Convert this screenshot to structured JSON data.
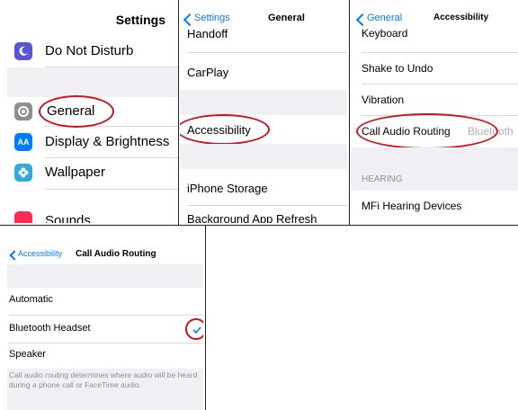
{
  "colors": {
    "accent": "#007aff",
    "highlight": "#d0101a",
    "group_bg": "#efeff4"
  },
  "panel1": {
    "title": "Settings",
    "items": [
      {
        "label": "Do Not Disturb",
        "icon": "moon-icon",
        "color": "#5856d6"
      },
      {
        "label": "General",
        "icon": "gear-icon",
        "color": "#8e8e93"
      },
      {
        "label": "Display & Brightness",
        "icon": "display-brightness-icon",
        "color": "#007aff"
      },
      {
        "label": "Wallpaper",
        "icon": "wallpaper-flower-icon",
        "color": "#34aadc"
      },
      {
        "label": "Sounds",
        "icon": "speaker-icon",
        "color": "#ff2d55"
      }
    ]
  },
  "panel2": {
    "back": "Settings",
    "title": "General",
    "items": [
      "Handoff",
      "CarPlay",
      "Accessibility",
      "iPhone Storage",
      "Background App Refresh"
    ]
  },
  "panel3": {
    "back": "General",
    "title": "Accessibility",
    "items": [
      "Keyboard",
      "Shake to Undo",
      "Vibration"
    ],
    "call_audio": {
      "label": "Call Audio Routing",
      "value": "Bluetooth"
    },
    "section_header": "HEARING",
    "hearing_items": [
      "MFi Hearing Devices"
    ]
  },
  "panel4": {
    "back": "Accessibility",
    "title": "Call Audio Routing",
    "options": [
      "Automatic",
      "Bluetooth Headset",
      "Speaker"
    ],
    "selected": "Bluetooth Headset",
    "footer": "Call audio routing determines where audio will be heard during a phone call or FaceTime audio."
  }
}
